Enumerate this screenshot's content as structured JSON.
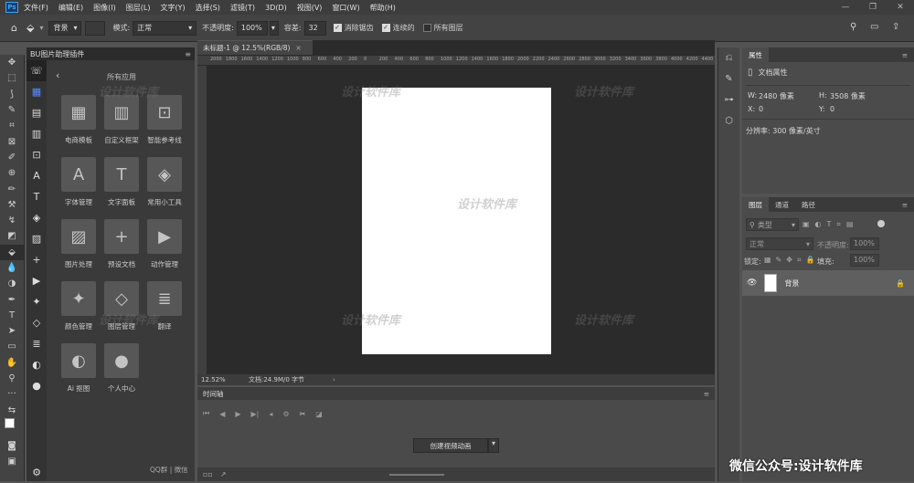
{
  "menu": {
    "items": [
      "文件(F)",
      "编辑(E)",
      "图像(I)",
      "图层(L)",
      "文字(Y)",
      "选择(S)",
      "滤镜(T)",
      "3D(D)",
      "视图(V)",
      "窗口(W)",
      "帮助(H)"
    ]
  },
  "options": {
    "layer_sel": "背景",
    "mode_label": "模式:",
    "mode_value": "正常",
    "opacity_label": "不透明度:",
    "opacity_value": "100%",
    "tolerance_label": "容差:",
    "tolerance_value": "32",
    "antialias": "消除锯齿",
    "contiguous": "连续的",
    "all_layers": "所有图层"
  },
  "plugin": {
    "title": "BU图片助理插件",
    "section": "所有应用",
    "footer": "QQ群 | 微信",
    "cards": [
      {
        "label": "电商模板",
        "icon": "▦"
      },
      {
        "label": "自定义框架",
        "icon": "▥"
      },
      {
        "label": "智能参考线",
        "icon": "⊡"
      },
      {
        "label": "字体管理",
        "icon": "A"
      },
      {
        "label": "文字面板",
        "icon": "T"
      },
      {
        "label": "常用小工具",
        "icon": "◈"
      },
      {
        "label": "图片处理",
        "icon": "▨"
      },
      {
        "label": "预设文档",
        "icon": "+"
      },
      {
        "label": "动作管理",
        "icon": "▶"
      },
      {
        "label": "颜色管理",
        "icon": "✦"
      },
      {
        "label": "图层管理",
        "icon": "◇"
      },
      {
        "label": "翻译",
        "icon": "≣"
      },
      {
        "label": "Ai 抠图",
        "icon": "◐"
      },
      {
        "label": "个人中心",
        "icon": "●"
      }
    ]
  },
  "document": {
    "tab": "未标题-1 @ 12.5%(RGB/8)",
    "zoom": "12.52%",
    "info": "文档:24.9M/0 字节",
    "ruler": [
      "2000",
      "1800",
      "1600",
      "1400",
      "1200",
      "1000",
      "800",
      "600",
      "400",
      "200",
      "0",
      "200",
      "400",
      "600",
      "800",
      "1000",
      "1200",
      "1400",
      "1600",
      "1800",
      "2000",
      "2200",
      "2400",
      "2600",
      "2800",
      "3000",
      "3200",
      "3400",
      "3600",
      "3800",
      "4000",
      "4200",
      "4400"
    ]
  },
  "timeline": {
    "title": "时间轴",
    "create_button": "创建视频动画"
  },
  "properties": {
    "tab": "属性",
    "doc_props": "文档属性",
    "w_label": "W:",
    "w_value": "2480 像素",
    "h_label": "H:",
    "h_value": "3508 像素",
    "x_label": "X:",
    "x_value": "0",
    "y_label": "Y:",
    "y_value": "0",
    "res": "分辨率: 300 像素/英寸"
  },
  "layers": {
    "tabs": [
      "图层",
      "通道",
      "路径"
    ],
    "filter": "类型",
    "blend": "正常",
    "opacity_label": "不透明度:",
    "opacity": "100%",
    "lock_label": "锁定:",
    "fill_label": "填充:",
    "fill": "100%",
    "layer_name": "背景"
  },
  "watermark": {
    "text": "微信公众号:设计软件库",
    "ghost": "设计软件库"
  }
}
